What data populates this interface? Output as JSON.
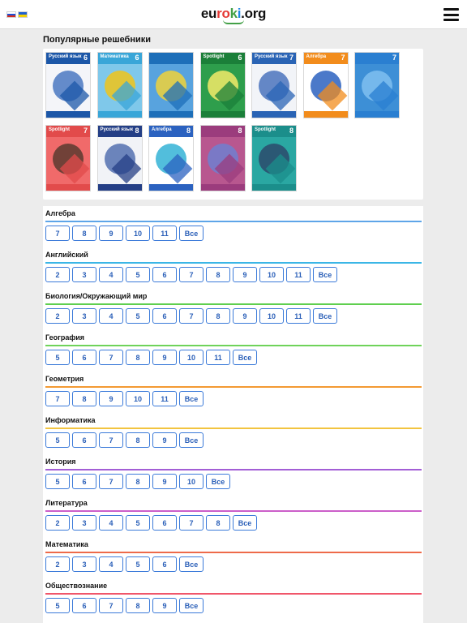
{
  "header": {
    "logo_text": "euroki.org",
    "logo_colors": [
      "#e53935",
      "#43a047",
      "#1e88e5",
      "#111111"
    ],
    "flags": [
      {
        "name": "ru-flag",
        "colors": [
          "#ffffff",
          "#1c4fd6",
          "#d52b1e"
        ]
      },
      {
        "name": "ua-flag",
        "colors": [
          "#1f5fd0",
          "#f5d000"
        ]
      }
    ],
    "menu_icon": "hamburger-menu-icon"
  },
  "popular": {
    "title": "Популярные решебники",
    "books": [
      {
        "title": "Русский язык",
        "grade": "6",
        "band": "#1c57a8",
        "body": "#f4f5f9",
        "accent": "#4a78c2"
      },
      {
        "title": "Математика",
        "grade": "6",
        "band": "#39a6d8",
        "body": "#7fc8ea",
        "accent": "#f0c419"
      },
      {
        "title": "",
        "grade": "",
        "band": "#1d6fb9",
        "body": "#58a3de",
        "accent": "#f0d23a"
      },
      {
        "title": "Spotlight",
        "grade": "6",
        "band": "#1b7f39",
        "body": "#2e9e4c",
        "accent": "#f3ea69"
      },
      {
        "title": "Русский язык",
        "grade": "7",
        "band": "#2a64b5",
        "body": "#f2f4f8",
        "accent": "#4b73bd"
      },
      {
        "title": "Алгебра",
        "grade": "7",
        "band": "#f28c1c",
        "body": "#ffffff",
        "accent": "#2b62c0"
      },
      {
        "title": "",
        "grade": "7",
        "band": "#2a7fd1",
        "body": "#3d8fd6",
        "accent": "#7fbff0"
      },
      {
        "title": "Spotlight",
        "grade": "7",
        "band": "#e24b4b",
        "body": "#f06a6a",
        "accent": "#5a3a2f"
      },
      {
        "title": "Русский язык",
        "grade": "8",
        "band": "#243f86",
        "body": "#f1f3f7",
        "accent": "#5370b0"
      },
      {
        "title": "Алгебра",
        "grade": "8",
        "band": "#2b62c0",
        "body": "#ffffff",
        "accent": "#34b3d6"
      },
      {
        "title": "",
        "grade": "8",
        "band": "#9b3c7d",
        "body": "#b8578f",
        "accent": "#6f7fd0"
      },
      {
        "title": "Spotlight",
        "grade": "8",
        "band": "#1b8e8b",
        "body": "#2aa7a2",
        "accent": "#2b4a6c"
      }
    ]
  },
  "subjects": [
    {
      "name": "Алгебра",
      "color": "#5ea5e8",
      "grades": [
        "7",
        "8",
        "9",
        "10",
        "11",
        "Все"
      ]
    },
    {
      "name": "Английский",
      "color": "#3bb6e6",
      "grades": [
        "2",
        "3",
        "4",
        "5",
        "6",
        "7",
        "8",
        "9",
        "10",
        "11",
        "Все"
      ]
    },
    {
      "name": "Биология/Окружающий мир",
      "color": "#5fcf4f",
      "grades": [
        "2",
        "3",
        "4",
        "5",
        "6",
        "7",
        "8",
        "9",
        "10",
        "11",
        "Все"
      ]
    },
    {
      "name": "География",
      "color": "#6fd35a",
      "grades": [
        "5",
        "6",
        "7",
        "8",
        "9",
        "10",
        "11",
        "Все"
      ]
    },
    {
      "name": "Геометрия",
      "color": "#f39a33",
      "grades": [
        "7",
        "8",
        "9",
        "10",
        "11",
        "Все"
      ]
    },
    {
      "name": "Информатика",
      "color": "#f2c440",
      "grades": [
        "5",
        "6",
        "7",
        "8",
        "9",
        "Все"
      ]
    },
    {
      "name": "История",
      "color": "#a35ed6",
      "grades": [
        "5",
        "6",
        "7",
        "8",
        "9",
        "10",
        "Все"
      ]
    },
    {
      "name": "Литература",
      "color": "#cc5ec9",
      "grades": [
        "2",
        "3",
        "4",
        "5",
        "6",
        "7",
        "8",
        "Все"
      ]
    },
    {
      "name": "Математика",
      "color": "#ee6a4a",
      "grades": [
        "2",
        "3",
        "4",
        "5",
        "6",
        "Все"
      ]
    },
    {
      "name": "Обществознание",
      "color": "#f0566a",
      "grades": [
        "5",
        "6",
        "7",
        "8",
        "9",
        "Все"
      ]
    }
  ]
}
